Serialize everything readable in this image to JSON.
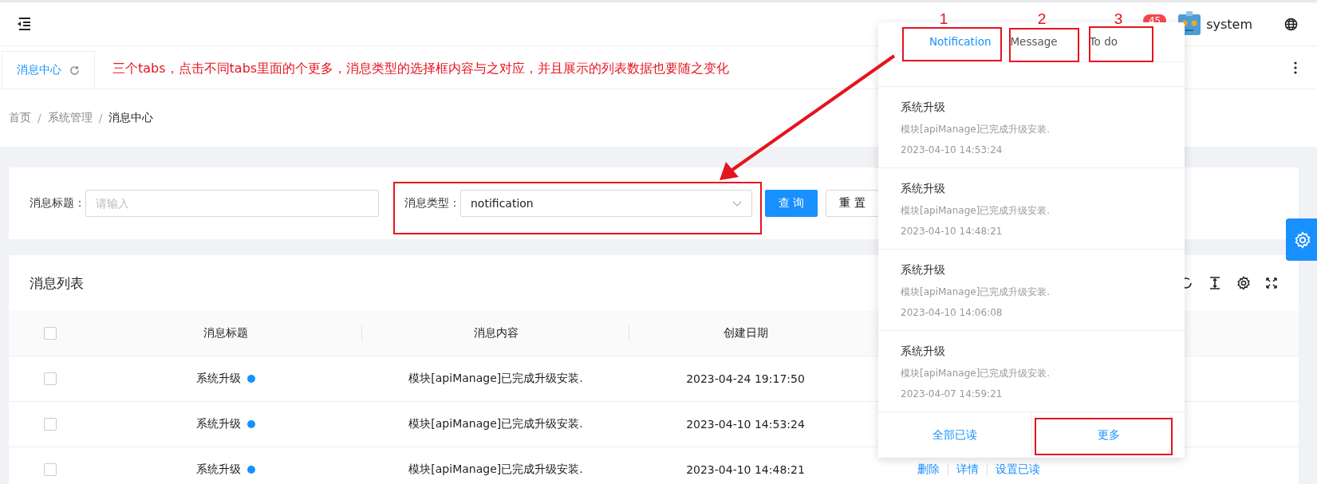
{
  "header": {
    "badge": "45",
    "user": "system"
  },
  "tabs": [
    {
      "label": "消息中心",
      "selected": true
    }
  ],
  "annotations": {
    "note": "三个tabs，点击不同tabs里面的个更多，消息类型的选择框内容与之对应，并且展示的列表数据也要随之变化",
    "numbers": [
      "1",
      "2",
      "3"
    ]
  },
  "breadcrumb": [
    "首页",
    "系统管理",
    "消息中心"
  ],
  "breadcrumb_separator": "/",
  "filter": {
    "fields": [
      {
        "kind": "input",
        "label": "消息标题：",
        "placeholder": "请输入"
      },
      {
        "kind": "select",
        "label": "消息类型：",
        "value": "notification"
      }
    ],
    "buttons": [
      {
        "label": "查 询",
        "primary": true
      },
      {
        "label": "重 置",
        "primary": false
      }
    ]
  },
  "table": {
    "title": "消息列表",
    "select_all": {
      "checked": false
    },
    "columns": [
      "消息标题",
      "消息内容",
      "创建日期"
    ],
    "rows": [
      {
        "checked": false,
        "title": "系统升级",
        "unread": true,
        "content": "模块[apiManage]已完成升级安装.",
        "date": "2023-04-24 19:17:50"
      },
      {
        "checked": false,
        "title": "系统升级",
        "unread": true,
        "content": "模块[apiManage]已完成升级安装.",
        "date": "2023-04-10 14:53:24"
      },
      {
        "checked": false,
        "title": "系统升级",
        "unread": true,
        "content": "模块[apiManage]已完成升级安装.",
        "date": "2023-04-10 14:48:21",
        "actions": [
          "删除",
          "详情",
          "设置已读"
        ]
      }
    ]
  },
  "popup": {
    "tabs": [
      {
        "label": "Notification",
        "selected": true
      },
      {
        "label": "Message",
        "selected": false
      },
      {
        "label": "To do",
        "selected": false
      }
    ],
    "items": [
      {
        "title": "系统升级",
        "content": "模块[apiManage]已完成升级安装.",
        "date": "2023-04-10 14:53:24"
      },
      {
        "title": "系统升级",
        "content": "模块[apiManage]已完成升级安装.",
        "date": "2023-04-10 14:48:21"
      },
      {
        "title": "系统升级",
        "content": "模块[apiManage]已完成升级安装.",
        "date": "2023-04-10 14:06:08"
      },
      {
        "title": "系统升级",
        "content": "模块[apiManage]已完成升级安装.",
        "date": "2023-04-07 14:59:21"
      }
    ],
    "footer": [
      "全部已读",
      "更多"
    ]
  }
}
